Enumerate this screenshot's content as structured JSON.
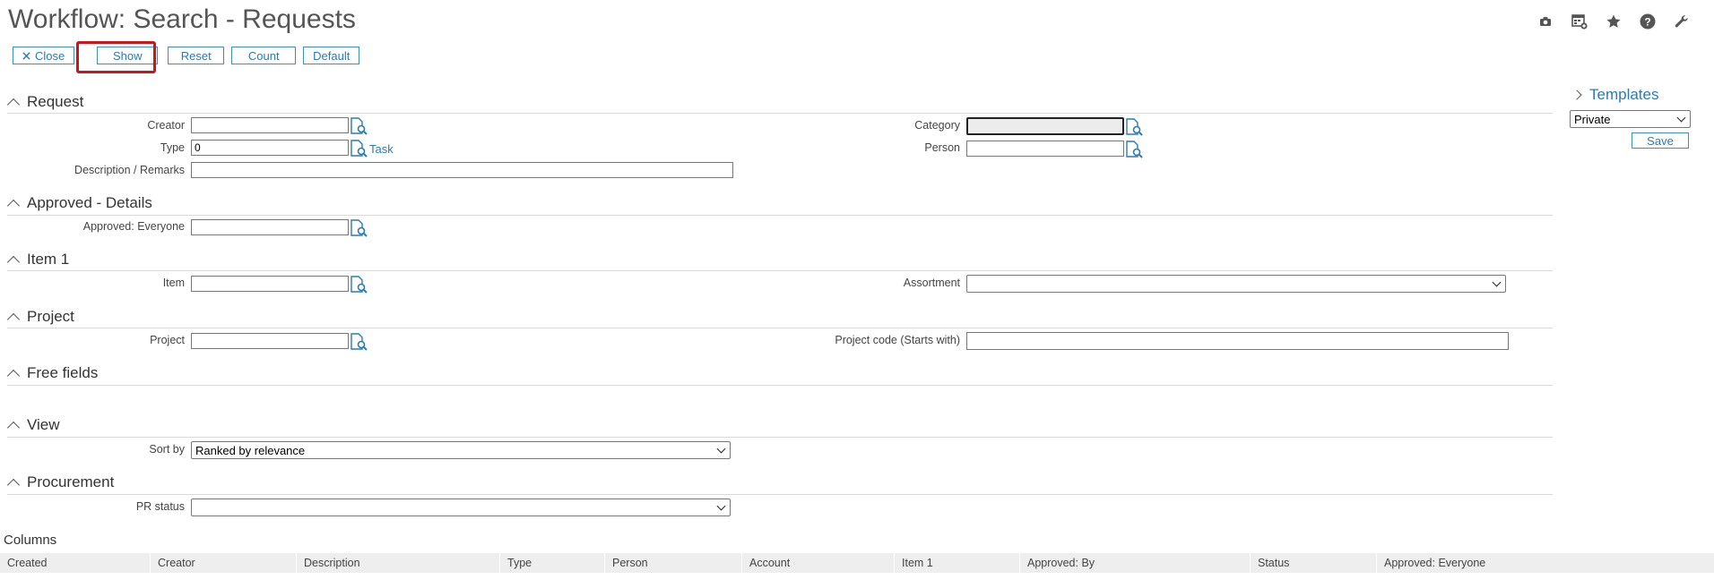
{
  "page": {
    "title": "Workflow: Search - Requests"
  },
  "top_icons": [
    "camera-icon",
    "calendar-add-icon",
    "star-icon",
    "help-icon",
    "wrench-icon"
  ],
  "toolbar": {
    "close_label": "Close",
    "show_label": "Show",
    "reset_label": "Reset",
    "count_label": "Count",
    "default_label": "Default"
  },
  "sections": {
    "request": {
      "title": "Request",
      "creator_label": "Creator",
      "creator_value": "",
      "type_label": "Type",
      "type_value": "0",
      "type_link": "Task",
      "description_label": "Description / Remarks",
      "description_value": "",
      "category_label": "Category",
      "category_value": "",
      "person_label": "Person",
      "person_value": ""
    },
    "approved_details": {
      "title": "Approved - Details",
      "approved_everyone_label": "Approved: Everyone",
      "approved_everyone_value": ""
    },
    "item1": {
      "title": "Item 1",
      "item_label": "Item",
      "item_value": "",
      "assortment_label": "Assortment",
      "assortment_value": ""
    },
    "project": {
      "title": "Project",
      "project_label": "Project",
      "project_value": "",
      "project_code_label": "Project code (Starts with)",
      "project_code_value": ""
    },
    "free_fields": {
      "title": "Free fields"
    },
    "view": {
      "title": "View",
      "sort_by_label": "Sort by",
      "sort_by_value": "Ranked by relevance"
    },
    "procurement": {
      "title": "Procurement",
      "pr_status_label": "PR status",
      "pr_status_value": ""
    }
  },
  "templates": {
    "title": "Templates",
    "scope_value": "Private",
    "save_label": "Save"
  },
  "columns": {
    "title": "Columns",
    "headers": [
      "Created",
      "Creator",
      "Description",
      "Type",
      "Person",
      "Account",
      "Item 1",
      "Approved: By",
      "Status",
      "Approved: Everyone"
    ]
  },
  "colors": {
    "accent": "#2a7ab8",
    "highlight": "#d0121b"
  }
}
